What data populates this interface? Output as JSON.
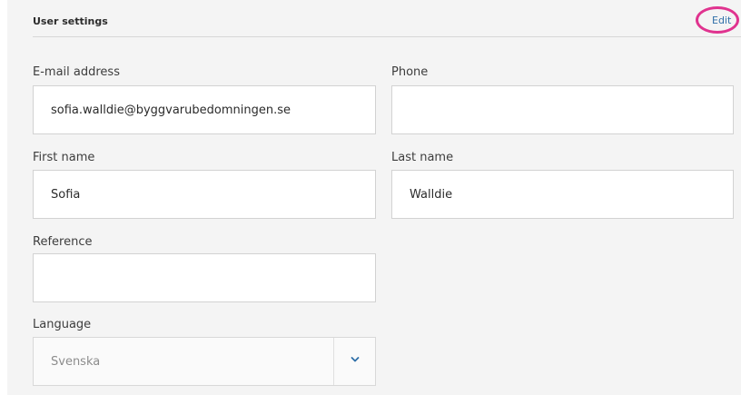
{
  "header": {
    "title": "User settings",
    "edit_label": "Edit"
  },
  "fields": {
    "email": {
      "label": "E-mail address",
      "value": "sofia.walldie@byggvarubedomningen.se"
    },
    "phone": {
      "label": "Phone",
      "value": ""
    },
    "first_name": {
      "label": "First name",
      "value": "Sofia"
    },
    "last_name": {
      "label": "Last name",
      "value": "Walldie"
    },
    "reference": {
      "label": "Reference",
      "value": ""
    },
    "language": {
      "label": "Language",
      "value": "Svenska"
    }
  },
  "icons": {
    "language_dropdown": "chevron-down-icon"
  },
  "colors": {
    "accent": "#2f6fa8",
    "highlight": "#e0338f",
    "panel_bg": "#f4f4f4"
  }
}
